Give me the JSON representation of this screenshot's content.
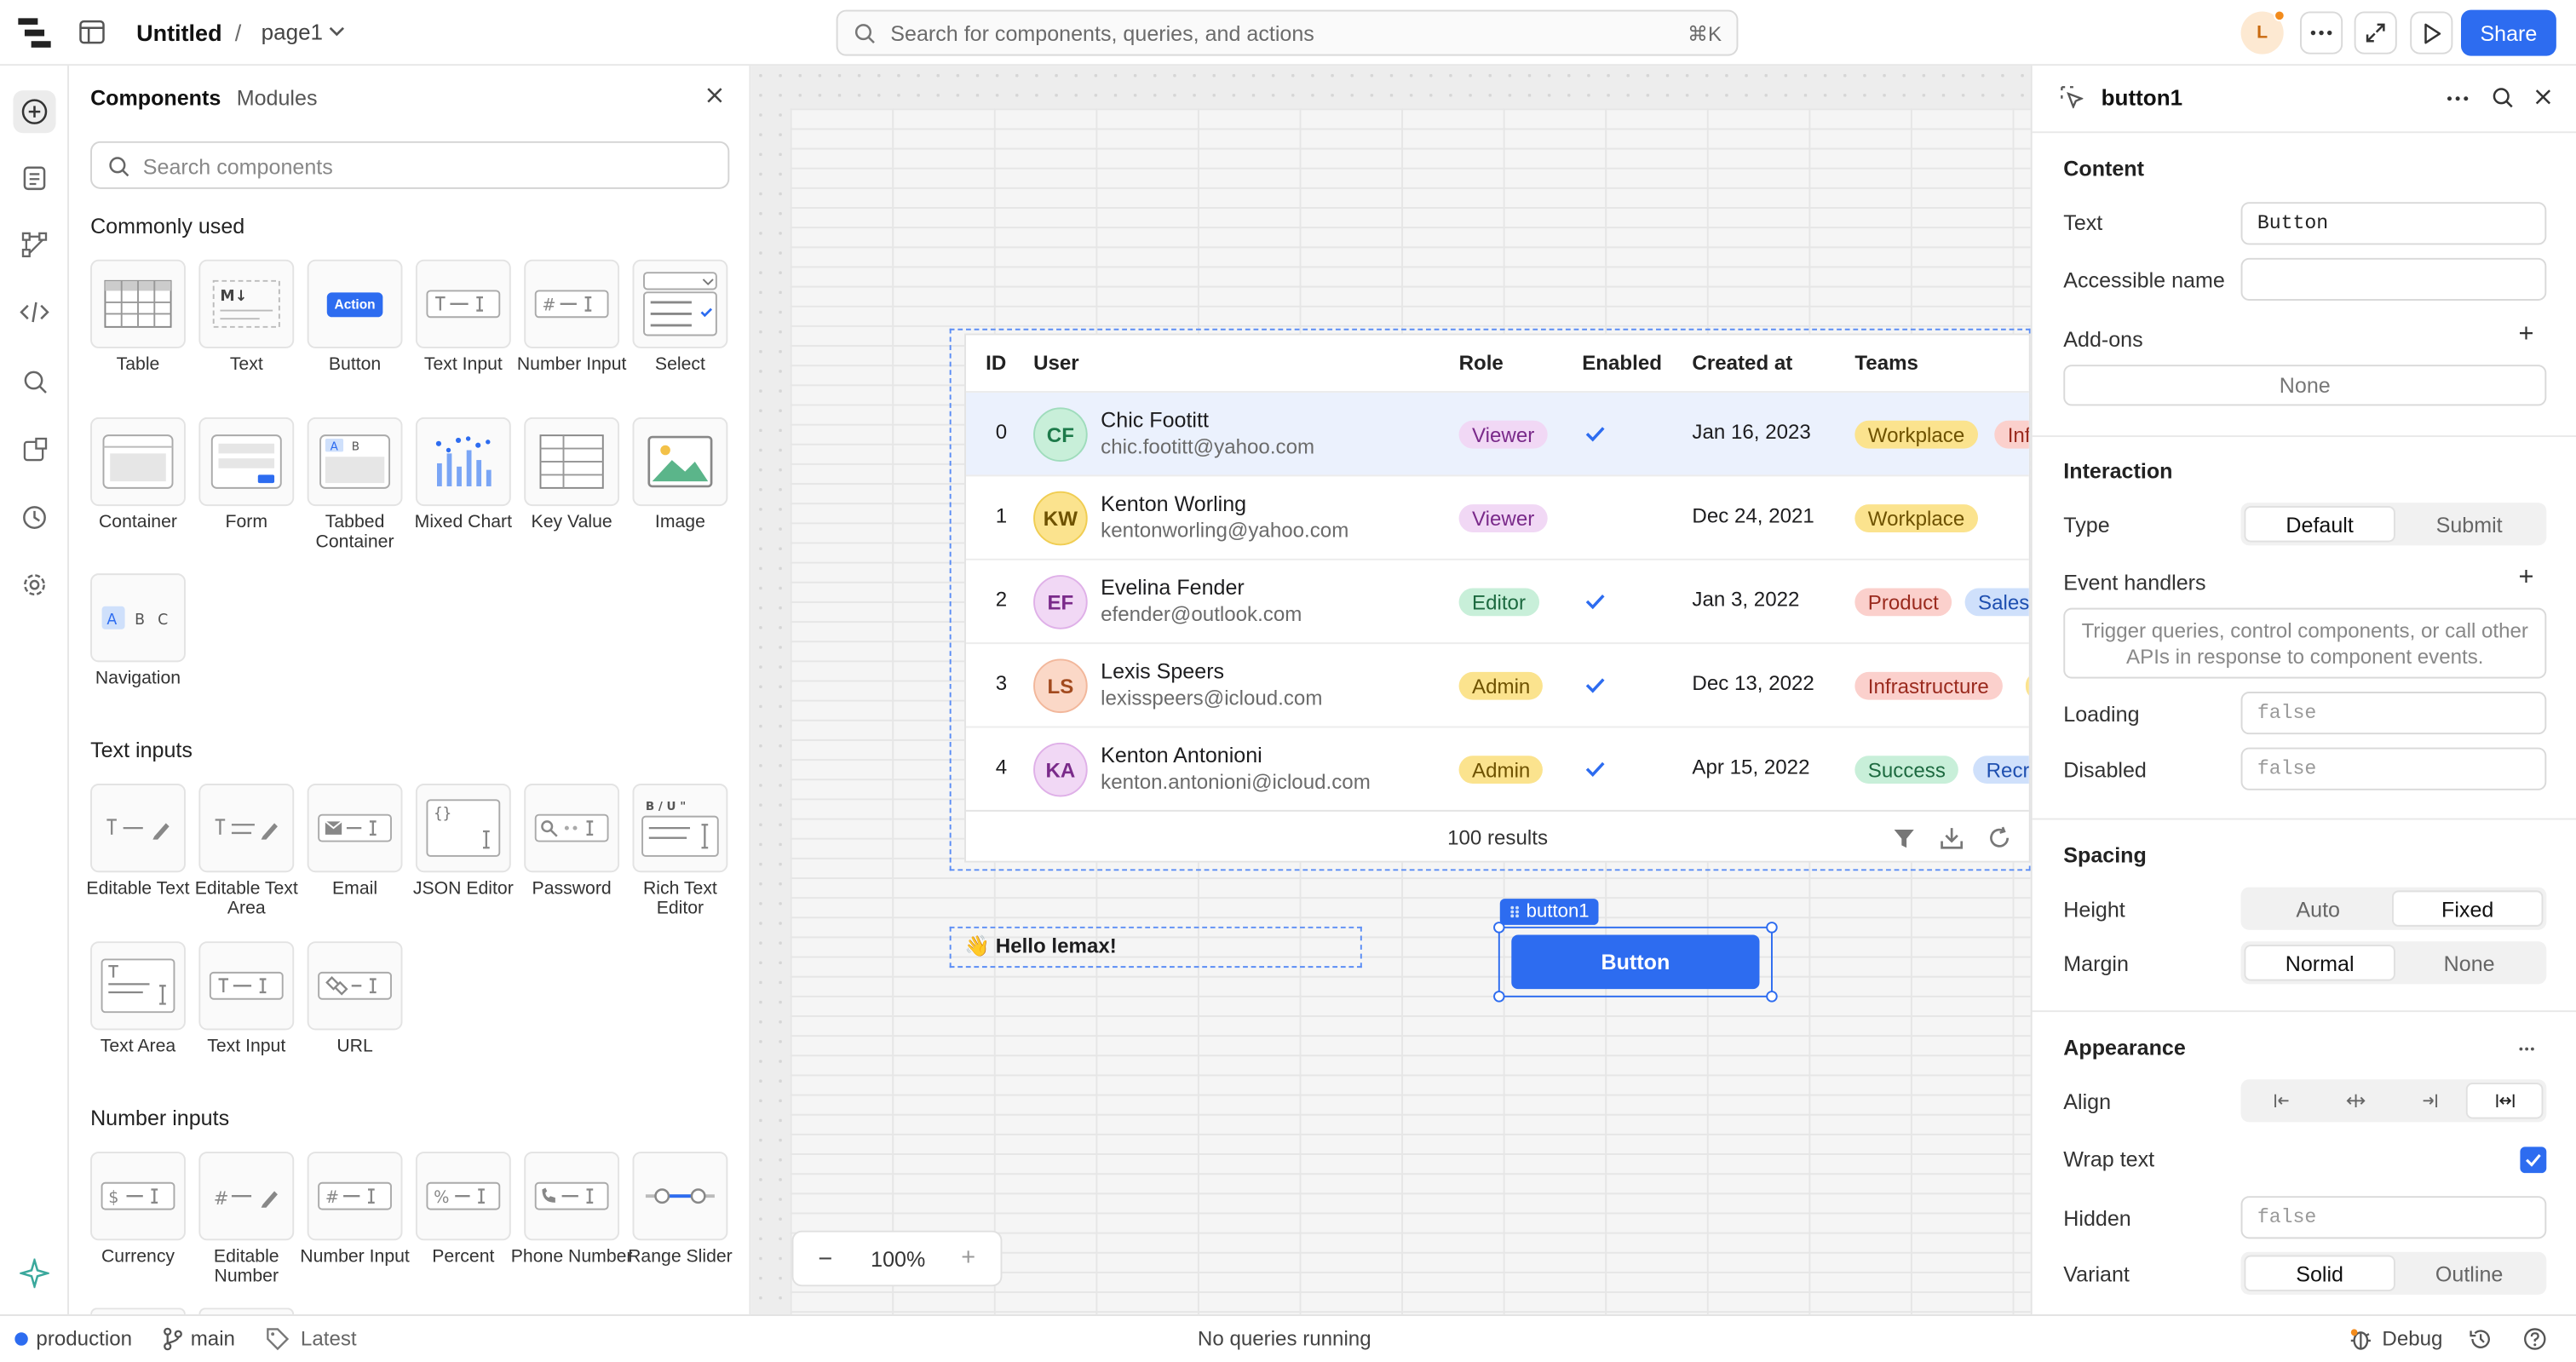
{
  "topbar": {
    "app_title": "Untitled",
    "separator": "/",
    "page_name": "page1",
    "search_placeholder": "Search for components, queries, and actions",
    "search_shortcut": "⌘K",
    "avatar_initial": "L",
    "share_label": "Share"
  },
  "panel": {
    "tab_components": "Components",
    "tab_modules": "Modules",
    "search_placeholder": "Search components",
    "sections": [
      {
        "title": "Commonly used",
        "items": [
          "Table",
          "Text",
          "Button",
          "Text Input",
          "Number Input",
          "Select",
          "Container",
          "Form",
          "Tabbed Container",
          "Mixed Chart",
          "Key Value",
          "Image",
          "Navigation"
        ]
      },
      {
        "title": "Text inputs",
        "items": [
          "Editable Text",
          "Editable Text Area",
          "Email",
          "JSON Editor",
          "Password",
          "Rich Text Editor",
          "Text Area",
          "Text Input",
          "URL"
        ]
      },
      {
        "title": "Number inputs",
        "items": [
          "Currency",
          "Editable Number",
          "Number Input",
          "Percent",
          "Phone Number",
          "Range Slider"
        ]
      }
    ],
    "button_tile_text": "Action",
    "text_tile_text": "M↓",
    "tabbed_a": "A",
    "tabbed_b": "B",
    "nav_a": "A",
    "nav_b": "B",
    "nav_c": "C",
    "rte_text": "B / U \""
  },
  "table": {
    "headers": [
      "ID",
      "User",
      "Role",
      "Enabled",
      "Created at",
      "Teams"
    ],
    "rows": [
      {
        "id": "0",
        "initials": "CF",
        "name": "Chic Footitt",
        "email": "chic.footitt@yahoo.com",
        "role": "Viewer",
        "enabled": true,
        "created": "Jan 16, 2023",
        "teams": [
          "Workplace",
          "Inf"
        ]
      },
      {
        "id": "1",
        "initials": "KW",
        "name": "Kenton Worling",
        "email": "kentonworling@yahoo.com",
        "role": "Viewer",
        "enabled": false,
        "created": "Dec 24, 2021",
        "teams": [
          "Workplace"
        ]
      },
      {
        "id": "2",
        "initials": "EF",
        "name": "Evelina Fender",
        "email": "efender@outlook.com",
        "role": "Editor",
        "enabled": true,
        "created": "Jan 3, 2022",
        "teams": [
          "Product",
          "Sales"
        ]
      },
      {
        "id": "3",
        "initials": "LS",
        "name": "Lexis Speers",
        "email": "lexisspeers@icloud.com",
        "role": "Admin",
        "enabled": true,
        "created": "Dec 13, 2022",
        "teams": [
          "Infrastructure",
          ""
        ]
      },
      {
        "id": "4",
        "initials": "KA",
        "name": "Kenton Antonioni",
        "email": "kenton.antonioni@icloud.com",
        "role": "Admin",
        "enabled": true,
        "created": "Apr 15, 2022",
        "teams": [
          "Success",
          "Recr"
        ]
      }
    ],
    "footer": "100 results"
  },
  "canvas": {
    "hello_text": "👋 Hello lemax!",
    "button_label": "Button",
    "selected_name": "button1",
    "zoom_value": "100%",
    "zoom_minus": "−",
    "zoom_plus": "+"
  },
  "inspector": {
    "title": "button1",
    "content_header": "Content",
    "text_label": "Text",
    "text_value": "Button",
    "accessible_label": "Accessible name",
    "addons_label": "Add-ons",
    "addons_value": "None",
    "interaction_header": "Interaction",
    "type_label": "Type",
    "type_default": "Default",
    "type_submit": "Submit",
    "events_label": "Event handlers",
    "events_placeholder": "Trigger queries, control components, or call other APIs in response to component events.",
    "loading_label": "Loading",
    "loading_value": "false",
    "disabled_label": "Disabled",
    "disabled_value": "false",
    "spacing_header": "Spacing",
    "height_label": "Height",
    "height_auto": "Auto",
    "height_fixed": "Fixed",
    "margin_label": "Margin",
    "margin_normal": "Normal",
    "margin_none": "None",
    "appearance_header": "Appearance",
    "align_label": "Align",
    "wrap_label": "Wrap text",
    "hidden_label": "Hidden",
    "hidden_value": "false",
    "variant_label": "Variant",
    "variant_solid": "Solid",
    "variant_outline": "Outline"
  },
  "bottombar": {
    "env": "production",
    "branch": "main",
    "tag": "Latest",
    "status": "No queries running",
    "debug": "Debug"
  },
  "colors": {
    "accent": "#2d6cf0",
    "viewer": "#f1d8f5",
    "editor": "#c8efd9",
    "admin": "#fbe38e",
    "workplace": "#fbe38e",
    "product": "#fbd0cc",
    "sales": "#cfe0fb",
    "infrastructure": "#fbd0cc",
    "success": "#c8efd9",
    "recr": "#cfe0fb"
  }
}
